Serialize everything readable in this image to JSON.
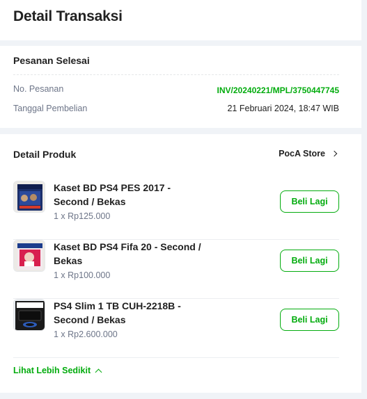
{
  "page": {
    "title": "Detail Transaksi"
  },
  "order": {
    "status": "Pesanan Selesai",
    "invoice_label": "No. Pesanan",
    "invoice_value": "INV/20240221/MPL/3750447745",
    "date_label": "Tanggal Pembelian",
    "date_value": "21 Februari 2024, 18:47 WIB"
  },
  "products": {
    "title": "Detail Produk",
    "store": "PocA Store",
    "buy_again_label": "Beli Lagi",
    "items": [
      {
        "name": "Kaset BD PS4 PES 2017 - Second / Bekas",
        "price": "1 x Rp125.000",
        "thumb": "ps4-pes2017-cover"
      },
      {
        "name": "Kaset BD PS4 Fifa 20 - Second / Bekas",
        "price": "1 x Rp100.000",
        "thumb": "ps4-fifa20-cover"
      },
      {
        "name": "PS4 Slim 1 TB CUH-2218B - Second / Bekas",
        "price": "1 x Rp2.600.000",
        "thumb": "ps4-slim-console"
      }
    ],
    "show_less": "Lihat Lebih Sedikit"
  },
  "colors": {
    "accent": "#03ac0e",
    "text": "#212121",
    "muted": "#6d7588",
    "bg": "#f0f3f7"
  }
}
